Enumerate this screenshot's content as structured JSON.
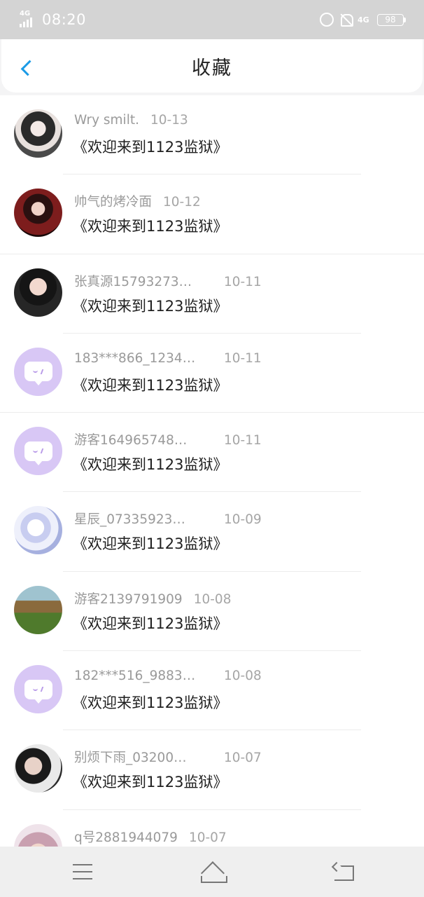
{
  "status_bar": {
    "network_left": "4G",
    "time": "08:20",
    "network_right": "4G",
    "battery": "98"
  },
  "header": {
    "title": "收藏"
  },
  "items": [
    {
      "name": "Wry smilt.",
      "date": "10-13",
      "title": "《欢迎来到1123监狱》",
      "avatar": "photo"
    },
    {
      "name": "帅气的烤冷面",
      "date": "10-12",
      "title": "《欢迎来到1123监狱》",
      "avatar": "photo"
    },
    {
      "name": "张真源15793273…",
      "date": "10-11",
      "title": "《欢迎来到1123监狱》",
      "avatar": "photo"
    },
    {
      "name": "183***866_1234…",
      "date": "10-11",
      "title": "《欢迎来到1123监狱》",
      "avatar": "default"
    },
    {
      "name": "游客164965748…",
      "date": "10-11",
      "title": "《欢迎来到1123监狱》",
      "avatar": "default"
    },
    {
      "name": "星辰_07335923…",
      "date": "10-09",
      "title": "《欢迎来到1123监狱》",
      "avatar": "photo"
    },
    {
      "name": "游客2139791909",
      "date": "10-08",
      "title": "《欢迎来到1123监狱》",
      "avatar": "photo"
    },
    {
      "name": "182***516_9883…",
      "date": "10-08",
      "title": "《欢迎来到1123监狱》",
      "avatar": "default"
    },
    {
      "name": "别烦下雨_03200…",
      "date": "10-07",
      "title": "《欢迎来到1123监狱》",
      "avatar": "photo"
    },
    {
      "name": "q号2881944079",
      "date": "10-07",
      "title": "",
      "avatar": "photo"
    }
  ],
  "icons": {
    "back": "chevron-left-icon",
    "default_avatar": "chat-bubble-icon",
    "nav": [
      "menu-icon",
      "home-icon",
      "back-icon"
    ]
  },
  "colors": {
    "accent": "#1b9be6",
    "default_avatar_bg": "#d8c7f5",
    "status_bar_bg": "#d4d4d4"
  }
}
